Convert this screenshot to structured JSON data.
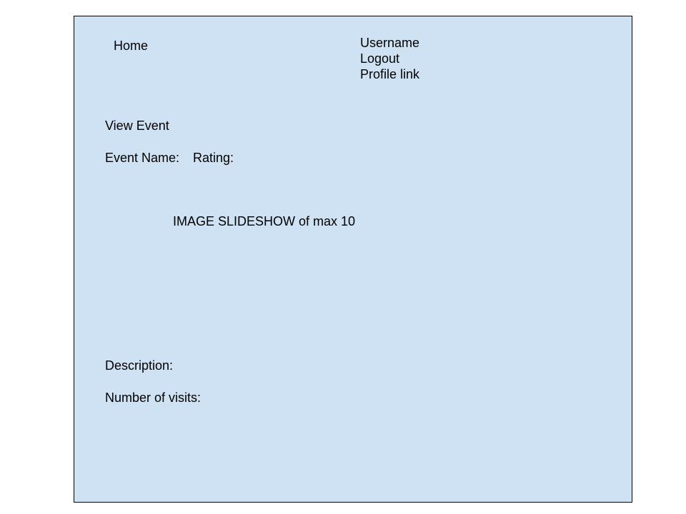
{
  "nav": {
    "home_label": "Home"
  },
  "account": {
    "username": "Username",
    "logout_label": "Logout",
    "profile_label": "Profile link"
  },
  "event": {
    "page_heading": "View Event",
    "name_label": "Event Name:",
    "rating_label": "Rating:",
    "slideshow_placeholder": "IMAGE SLIDESHOW of max 10",
    "description_label": "Description:",
    "visits_label": "Number of visits:"
  },
  "colors": {
    "page_background": "#cfe2f3",
    "border": "#000000"
  }
}
